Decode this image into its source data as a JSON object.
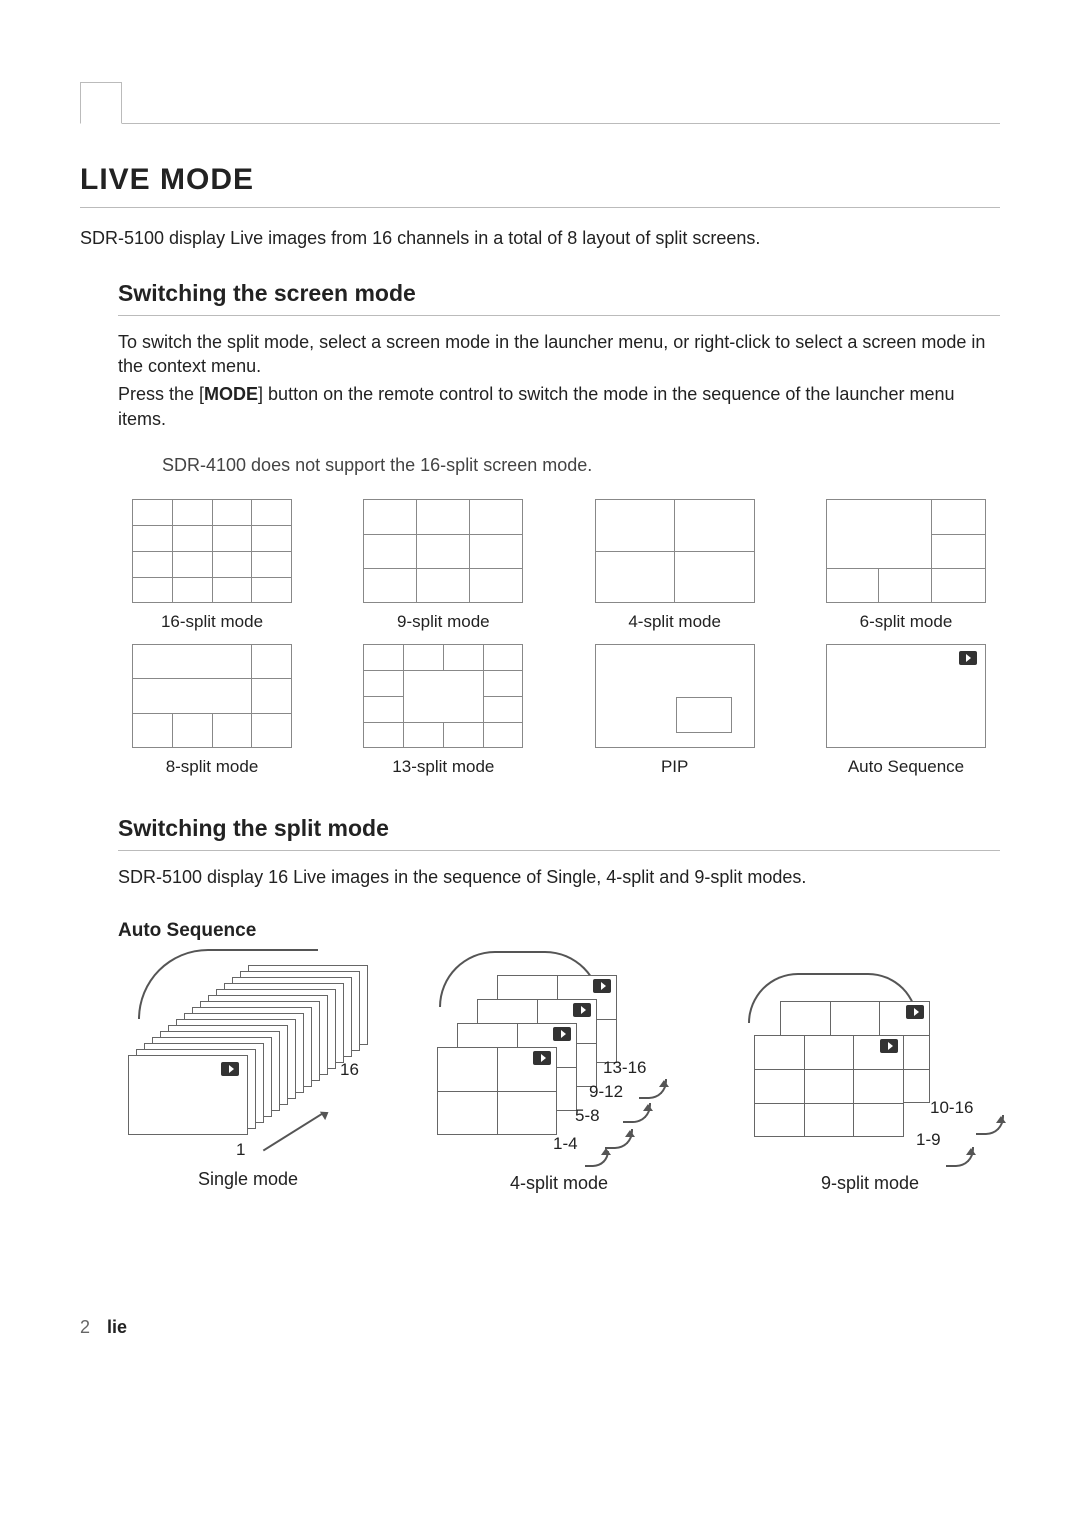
{
  "headings": {
    "h1": "LIVE MODE",
    "h2a": "Switching the screen mode",
    "h2b": "Switching the split mode",
    "h3": "Auto Sequence"
  },
  "intro": "SDR-5100 display Live images from 16 channels in a total of 8 layout of split screens.",
  "switch_screen_p1": "To switch the split mode, select a screen mode in the launcher menu, or right-click to select a screen mode in the context menu.",
  "switch_screen_p2a": "Press the [",
  "switch_screen_mode_word": "MODE",
  "switch_screen_p2b": "] button on the remote control to switch the mode in the sequence of the launcher menu items.",
  "note": "SDR-4100 does not support the 16-split screen mode.",
  "grid_labels": {
    "r1c1": "16-split mode",
    "r1c2": "9-split mode",
    "r1c3": "4-split mode",
    "r1c4": "6-split mode",
    "r2c1": "8-split mode",
    "r2c2": "13-split mode",
    "r2c3": "PIP",
    "r2c4": "Auto Sequence"
  },
  "switch_split_p": "SDR-5100 display 16 Live images in the sequence of Single, 4-split and 9-split modes.",
  "diag": {
    "single_label": "Single mode",
    "single_1": "1",
    "single_16": "16",
    "four_label": "4-split mode",
    "four_r1": "13-16",
    "four_r2": "9-12",
    "four_r3": "5-8",
    "four_r4": "1-4",
    "nine_label": "9-split mode",
    "nine_r1": "10-16",
    "nine_r2": "1-9"
  },
  "footer": {
    "page": "2",
    "word": "lie"
  }
}
